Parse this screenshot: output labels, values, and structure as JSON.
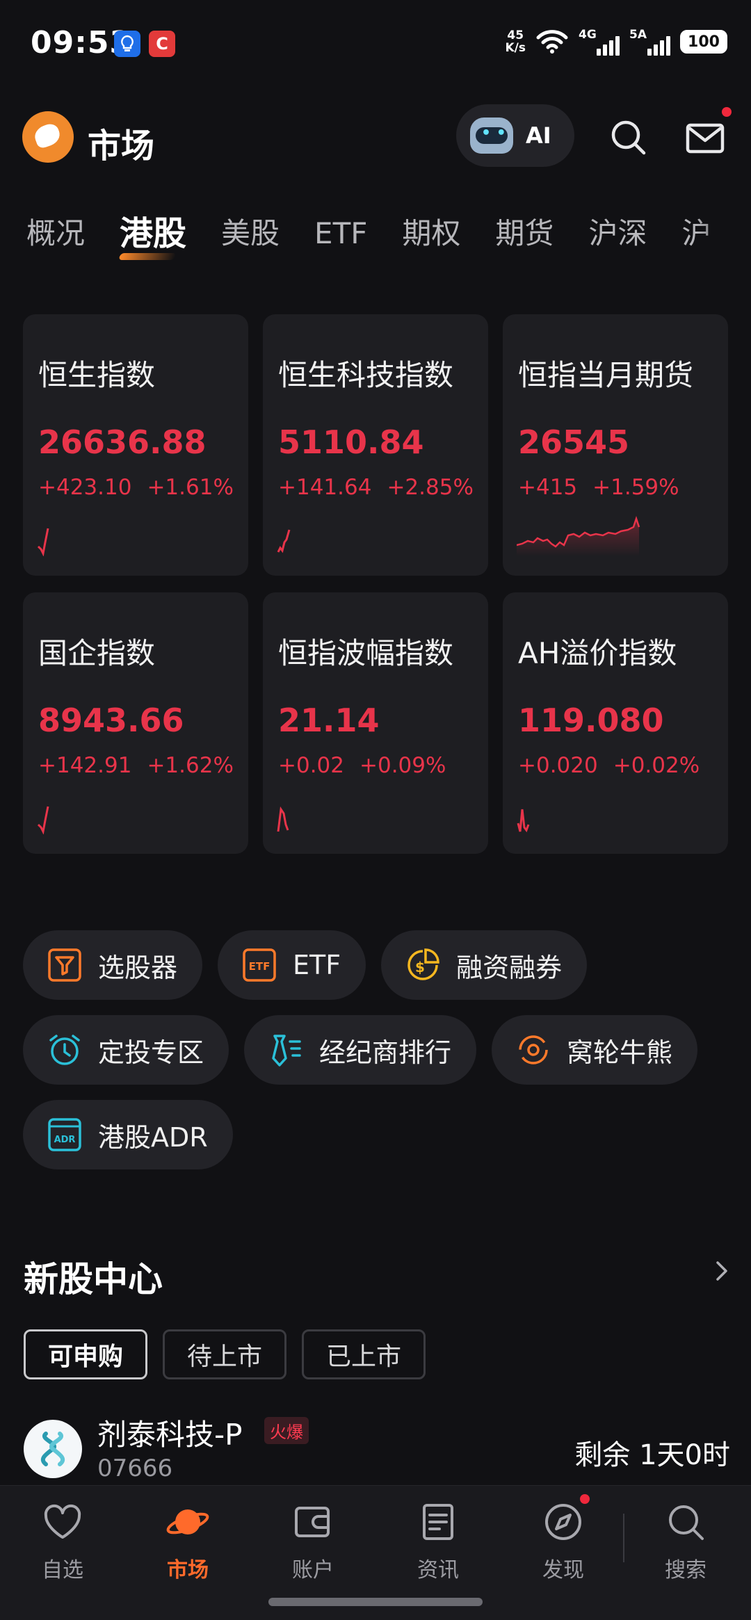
{
  "status_bar": {
    "time": "09:53",
    "app_badges": [
      "💡",
      "C"
    ],
    "net_speed_top": "45",
    "net_speed_bottom": "K/s",
    "signal1_label": "4G",
    "signal2_label": "5A",
    "battery": "100"
  },
  "header": {
    "title": "市场",
    "ai_label": "AI"
  },
  "tabs": [
    "概况",
    "港股",
    "美股",
    "ETF",
    "期权",
    "期货",
    "沪深",
    "沪"
  ],
  "active_tab": 1,
  "index_cards": [
    {
      "name": "恒生指数",
      "price": "26636.88",
      "change": "+423.10",
      "pct": "+1.61%"
    },
    {
      "name": "恒生科技指数",
      "price": "5110.84",
      "change": "+141.64",
      "pct": "+2.85%"
    },
    {
      "name": "恒指当月期货",
      "price": "26545",
      "change": "+415",
      "pct": "+1.59%"
    },
    {
      "name": "国企指数",
      "price": "8943.66",
      "change": "+142.91",
      "pct": "+1.62%"
    },
    {
      "name": "恒指波幅指数",
      "price": "21.14",
      "change": "+0.02",
      "pct": "+0.09%"
    },
    {
      "name": "AH溢价指数",
      "price": "119.080",
      "change": "+0.020",
      "pct": "+0.02%"
    }
  ],
  "quick_functions": {
    "row1": [
      "选股器",
      "ETF",
      "融资融券"
    ],
    "row2": [
      "定投专区",
      "经纪商排行",
      "窝轮牛熊"
    ],
    "row3": [
      "港股ADR"
    ]
  },
  "ipo_center": {
    "title": "新股中心",
    "tabs": [
      "可申购",
      "待上市",
      "已上市"
    ],
    "item": {
      "name": "剂泰科技-P",
      "badge": "火爆",
      "code": "07666",
      "remaining": "剩余 1天0时"
    }
  },
  "bottom_nav": [
    "自选",
    "市场",
    "账户",
    "资讯",
    "发现",
    "搜索"
  ],
  "colors": {
    "up": "#e8344a",
    "accent": "#ff6a2b",
    "background": "#111114",
    "card": "#1e1e22"
  }
}
